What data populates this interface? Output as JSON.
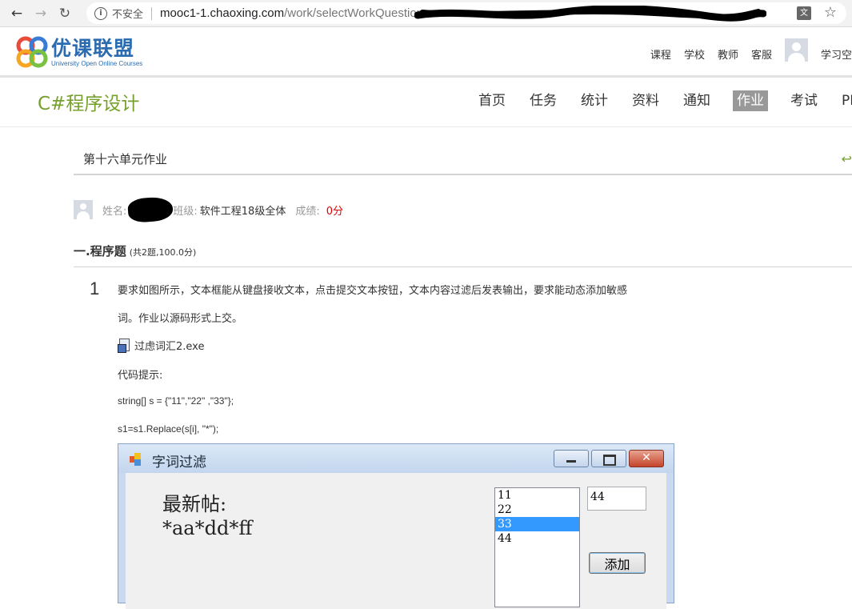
{
  "browser": {
    "security_label": "不安全",
    "url_host": "mooc1-1.chaoxing.com",
    "url_path": "/work/selectWorkQuestion"
  },
  "site": {
    "logo_cn": "优课联盟",
    "logo_en": "University Open Online Courses",
    "top_links": [
      "课程",
      "学校",
      "教师",
      "客服"
    ],
    "study_space": "学习空"
  },
  "course": {
    "title": "C#程序设计",
    "nav": [
      "首页",
      "任务",
      "统计",
      "资料",
      "通知",
      "作业",
      "考试",
      "PBL"
    ],
    "active_nav": "作业"
  },
  "homework": {
    "title": "第十六单元作业",
    "name_label": "姓名:",
    "class_label": "班级:",
    "class_value": "软件工程18级全体",
    "score_label": "成绩:",
    "score_value": "0分"
  },
  "section": {
    "title": "一.程序题",
    "subtitle": "(共2题,100.0分)"
  },
  "question": {
    "number": "1",
    "line1": "要求如图所示，文本框能从键盘接收文本，点击提交文本按钮，文本内容过滤后发表输出，要求能动态添加敏感",
    "line2": "词。作业以源码形式上交。",
    "attachment": "过虑词汇2.exe",
    "hint_label": "代码提示:",
    "code1": "string[] s = {\"11\",\"22\" ,\"33\"};",
    "code2": "s1=s1.Replace(s[i], \"*\");"
  },
  "winform": {
    "title": "字词过滤",
    "label_text": "最新帖:\n*aa*dd*ff",
    "list_items": [
      "11",
      "22",
      "33",
      "44"
    ],
    "selected_item": "33",
    "input_value": "44",
    "add_button": "添加"
  }
}
